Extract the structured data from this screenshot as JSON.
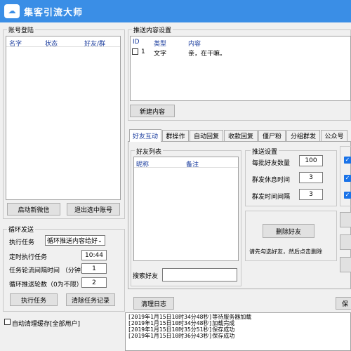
{
  "app": {
    "title": "集客引流大师"
  },
  "accounts": {
    "group_title": "账号登陆",
    "columns": [
      "名字",
      "状态",
      "好友/群"
    ],
    "start_button": "启动新微信",
    "logout_button": "退出选中账号"
  },
  "loop": {
    "group_title": "循环发送",
    "task_label": "执行任务",
    "task_value": "循环推送内容给好",
    "timed_label": "定时执行任务",
    "timed_value": "10:44",
    "interval_label": "任务轮流间隔时间 （分钟）",
    "interval_value": "1",
    "rounds_label": "循环推送轮数（0为不限）",
    "rounds_value": "2",
    "run_button": "执行任务",
    "clear_button": "清除任务记录"
  },
  "auto_clear": {
    "label": "自动清理缓存[全部用户]"
  },
  "push_content": {
    "group_title": "推送内容设置",
    "columns": [
      "ID",
      "类型",
      "内容"
    ],
    "rows": [
      {
        "id": "1",
        "type": "文字",
        "content": "亲，在干嘛。"
      }
    ],
    "new_button": "新建内容"
  },
  "tabs": [
    "好友互动",
    "群操作",
    "自动回复",
    "收款回复",
    "僵尸粉",
    "分组群发",
    "公众号"
  ],
  "friends": {
    "group_title": "好友列表",
    "columns": [
      "昵称",
      "备注"
    ],
    "search_label": "搜索好友"
  },
  "push_settings": {
    "group_title": "推送设置",
    "batch_label": "每批好友数量",
    "batch_value": "100",
    "rest_label": "群发休息时间",
    "rest_value": "3",
    "gap_label": "群发时间间隔",
    "gap_value": "3"
  },
  "delete": {
    "button": "删除好友",
    "hint": "请先勾选好友，然后点击删除"
  },
  "log": {
    "clear_button": "清理日志",
    "save_button_partial": "保",
    "lines": [
      "[2019年1月15日10时34分48秒]等待服务器加载",
      "[2019年1月15日10时34分48秒]加载完成",
      "[2019年1月15日10时35分51秒]保存成功",
      "[2019年1月15日10时36分43秒]保存成功"
    ]
  },
  "colors": {
    "titlebar": "#3a8ee6",
    "header_text": "#1a3c9e",
    "checkbox": "#1a73e8"
  }
}
